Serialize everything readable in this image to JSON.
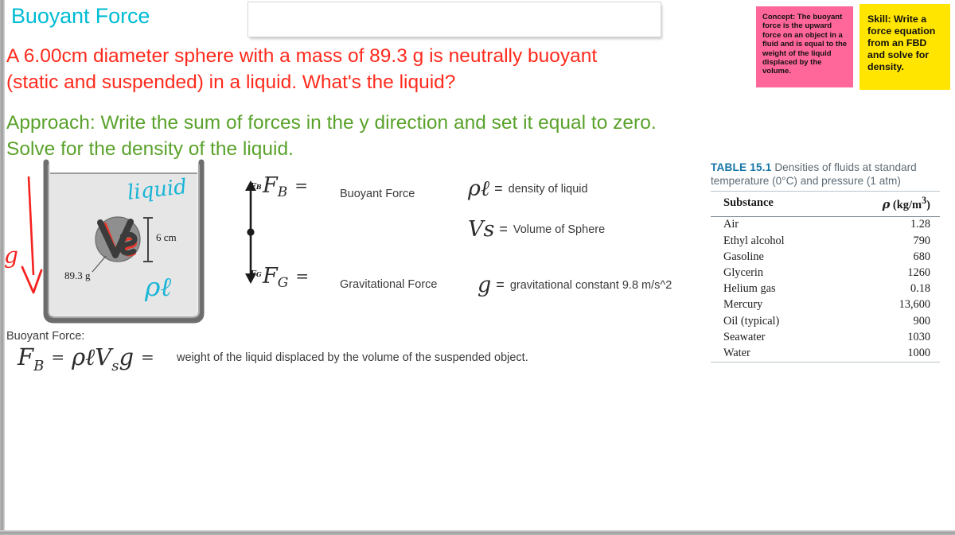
{
  "slide": {
    "title": "Buoyant Force",
    "problem_line1": "A 6.00cm diameter sphere with a mass of 89.3 g is neutrally buoyant",
    "problem_line2": "(static and suspended) in a  liquid.  What's the liquid?",
    "approach_line1": "Approach:  Write the sum of forces in the y direction and set it equal to zero.",
    "approach_line2": "Solve for the density of the liquid.",
    "empty_textbox_value": ""
  },
  "callouts": {
    "concept": {
      "text": "Concept:  The buoyant force is the upward force on an object in a fluid and is equal to the weight of the liquid displaced by the volume.",
      "color": "#FF6699"
    },
    "skill": {
      "text": "Skill:  Write a force equation from an FBD and solve for density.",
      "color": "#FFE500"
    }
  },
  "figure": {
    "gravity_label": "g",
    "liquid_annotation": "liquid",
    "density_annotation": "ρℓ",
    "sphere_volume_annotation": "Vs",
    "diameter_label": "6 cm",
    "mass_label": "89.3 g"
  },
  "fbd": {
    "up_force_symbol": "F",
    "up_force_sub": "B",
    "down_force_symbol": "F",
    "down_force_sub": "G",
    "up_force_name": "Buoyant Force",
    "down_force_name": "Gravitational Force",
    "equals": "="
  },
  "definitions": [
    {
      "symbol": "ρ",
      "sub": "ℓ",
      "equals": "=",
      "meaning": "density of liquid"
    },
    {
      "symbol": "V",
      "sub": "s",
      "equals": "=",
      "meaning": "Volume of Sphere"
    },
    {
      "symbol": "g",
      "sub": "",
      "equals": "=",
      "meaning": "gravitational constant 9.8 m/s^2"
    }
  ],
  "buoyant_equation": {
    "label": "Buoyant Force:",
    "lhs": "F",
    "lhs_sub": "B",
    "equals1": "=",
    "rhs": "ρℓV",
    "rhs_sub": "s",
    "rhs_tail": "g",
    "equals2": "=",
    "description": "weight of the liquid displaced by the volume of the suspended object."
  },
  "table": {
    "number": "TABLE 15.1",
    "caption": "Densities of fluids at standard temperature (0°C) and pressure (1 atm)",
    "columns": [
      "Substance",
      "ρ (kg/m³)"
    ],
    "rows": [
      {
        "substance": "Air",
        "density": "1.28"
      },
      {
        "substance": "Ethyl alcohol",
        "density": "790"
      },
      {
        "substance": "Gasoline",
        "density": "680"
      },
      {
        "substance": "Glycerin",
        "density": "1260"
      },
      {
        "substance": "Helium gas",
        "density": "0.18"
      },
      {
        "substance": "Mercury",
        "density": "13,600"
      },
      {
        "substance": "Oil (typical)",
        "density": "900"
      },
      {
        "substance": "Seawater",
        "density": "1030"
      },
      {
        "substance": "Water",
        "density": "1000"
      }
    ]
  }
}
